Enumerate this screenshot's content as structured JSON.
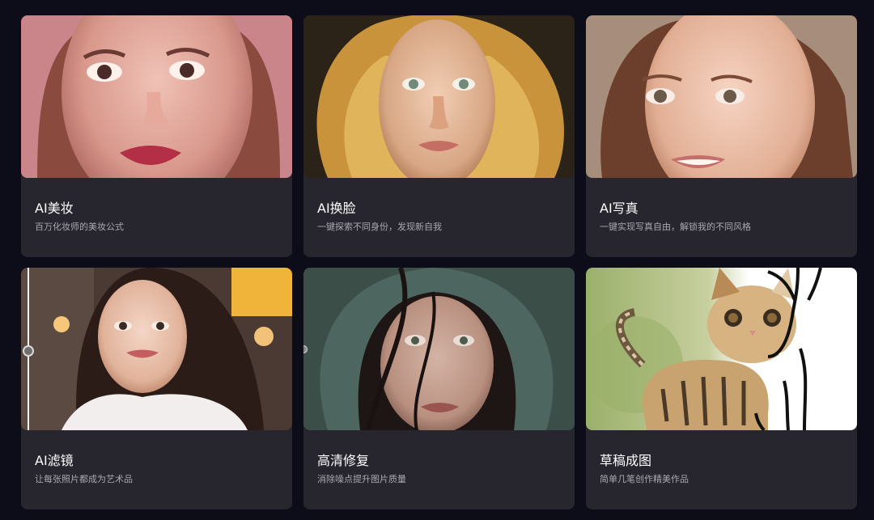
{
  "cards": [
    {
      "title": "AI美妆",
      "desc": "百万化妆师的美妆公式"
    },
    {
      "title": "AI换脸",
      "desc": "一键探索不同身份，发现新自我"
    },
    {
      "title": "AI写真",
      "desc": "一键实现写真自由，解锁我的不同风格"
    },
    {
      "title": "AI滤镜",
      "desc": "让每张照片都成为艺术品"
    },
    {
      "title": "高清修复",
      "desc": "消除噪点提升图片质量"
    },
    {
      "title": "草稿成图",
      "desc": "简单几笔创作精美作品"
    }
  ],
  "colors": {
    "background": "#0c0d19",
    "card": "#27262f",
    "title": "#ffffff",
    "desc": "#a9a8b0"
  }
}
